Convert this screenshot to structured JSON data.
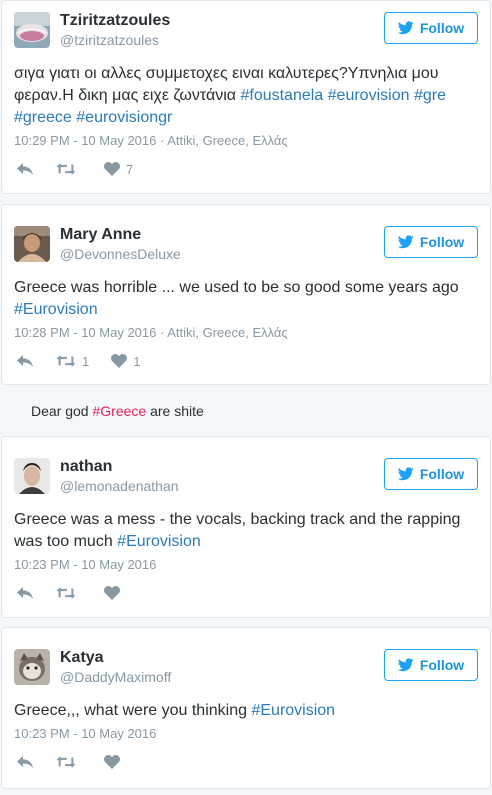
{
  "tweets": [
    {
      "name": "Tziritzatzoules",
      "handle": "@tziritzatzoules",
      "follow": "Follow",
      "text_pre": "σιγα γιατι οι αλλες συμμετοχες ειναι καλυτερες?Υπνηλια μου φεραν.Η δικη μας ειχε ζωντάνια ",
      "tags": [
        "#foustanela",
        "#eurovision",
        "#gre",
        "#greece",
        "#eurovisiongr"
      ],
      "time": "10:29 PM - 10 May 2016",
      "location": " · Attiki, Greece, Ελλάς",
      "retweets": "",
      "likes": "7"
    },
    {
      "name": "Mary Anne",
      "handle": "@DevonnesDeluxe",
      "follow": "Follow",
      "text": "Greece was horrible ... we used to be so good some years ago",
      "tag": "#Eurovision",
      "time": "10:28 PM - 10 May 2016",
      "location": " · Attiki, Greece, Ελλάς",
      "retweets": "1",
      "likes": "1"
    },
    {
      "name": "nathan",
      "handle": "@lemonadenathan",
      "follow": "Follow",
      "text": "Greece was a mess - the vocals, backing track and the rapping was too much",
      "tag": "#Eurovision",
      "time": "10:23 PM - 10 May 2016",
      "retweets": "",
      "likes": ""
    },
    {
      "name": "Katya",
      "handle": "@DaddyMaximoff",
      "follow": "Follow",
      "text": "Greece,,, what were you thinking",
      "tag": "#Eurovision",
      "time": "10:23 PM - 10 May 2016",
      "retweets": "",
      "likes": ""
    }
  ],
  "caption": {
    "pre": "Dear god ",
    "tag": "#Greece",
    "post": " are shite"
  },
  "colors": {
    "link": "#2b7bb9",
    "follow_border": "#1da1f2",
    "muted": "#8899a6",
    "hashtag_hot": "#e0245e"
  },
  "icons": [
    "twitter-bird-icon",
    "reply-icon",
    "retweet-icon",
    "heart-icon"
  ]
}
